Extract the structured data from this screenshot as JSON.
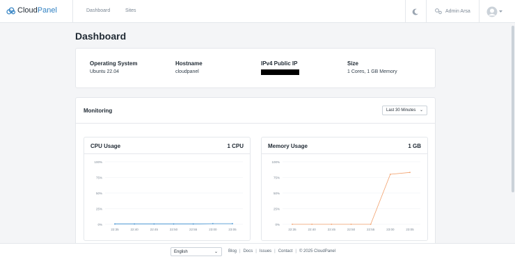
{
  "app": {
    "logo_text": "Cloud",
    "logo_accent": "Panel"
  },
  "nav": {
    "dashboard": "Dashboard",
    "sites": "Sites"
  },
  "user": {
    "name": "Admin Arsa"
  },
  "page": {
    "title": "Dashboard"
  },
  "server_info": {
    "os": {
      "label": "Operating System",
      "value": "Ubuntu 22.04"
    },
    "hostname": {
      "label": "Hostname",
      "value": "cloudpanel"
    },
    "ip": {
      "label": "IPv4 Public IP",
      "value": ""
    },
    "size": {
      "label": "Size",
      "value": "1 Cores, 1 GB Memory"
    }
  },
  "monitoring": {
    "title": "Monitoring",
    "range": "Last 30 Minutes"
  },
  "chart_data": [
    {
      "type": "line",
      "title": "CPU Usage",
      "meta": "1 CPU",
      "categories": [
        "22:35",
        "22:40",
        "22:45",
        "22:50",
        "22:55",
        "23:00",
        "23:05"
      ],
      "series": [
        {
          "values": [
            0.5,
            0.5,
            0.5,
            0.5,
            0.5,
            1,
            1
          ]
        }
      ],
      "yticks": [
        "100%",
        "75%",
        "50%",
        "25%",
        "0%"
      ],
      "ylim": [
        0,
        100
      ],
      "color": "#3b8fd0"
    },
    {
      "type": "line",
      "title": "Memory Usage",
      "meta": "1 GB",
      "categories": [
        "22:35",
        "22:40",
        "22:45",
        "22:50",
        "22:55",
        "23:00",
        "23:05"
      ],
      "series": [
        {
          "values": [
            0,
            0,
            0,
            0,
            0,
            80,
            83
          ]
        }
      ],
      "yticks": [
        "100%",
        "75%",
        "50%",
        "25%",
        "0%"
      ],
      "ylim": [
        0,
        100
      ],
      "color": "#f2a06b"
    }
  ],
  "footer": {
    "language": "English",
    "links": [
      "Blog",
      "Docs",
      "Issues",
      "Contact"
    ],
    "copyright": "© 2025 CloudPanel"
  }
}
